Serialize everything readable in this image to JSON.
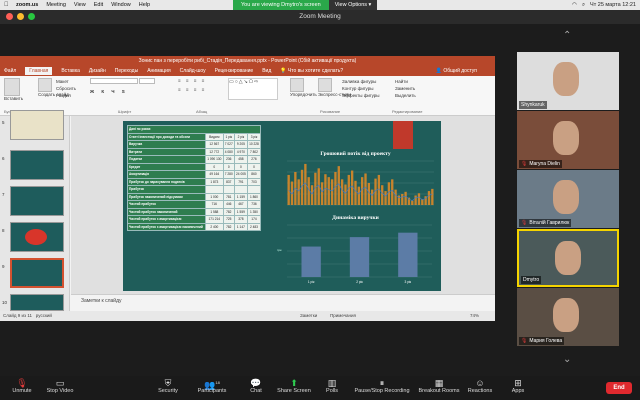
{
  "menubar": {
    "app": "zoom.us",
    "items": [
      "Meeting",
      "View",
      "Edit",
      "Window",
      "Help"
    ],
    "viewing_banner": "You are viewing Dmytro's screen",
    "view_options": "View Options",
    "clock": "Чт 25 марта 12:21"
  },
  "window": {
    "title": "Zoom Meeting"
  },
  "ppt": {
    "title_bar": "Зонис пан з переробіти рибі_Стадія_Передавання.pptx - PowerPoint (Сбій активації продукта)",
    "tabs": [
      "Файл",
      "Главная",
      "Вставка",
      "Дизайн",
      "Переходы",
      "Анимация",
      "Слайд-шоу",
      "Рецензирование",
      "Вид"
    ],
    "active_tab": "Главная",
    "tell_me": "Что вы хотите сделать?",
    "share": "Общий доступ",
    "groups": {
      "clipboard": "Буфер обмена",
      "paste": "Вставить",
      "slides": "Слайды",
      "new_slide": "Создать слайд",
      "layout": "Макет",
      "reset": "Сбросить",
      "section": "Раздел",
      "font": "Шрифт",
      "paragraph": "Абзац",
      "arrange": "Упорядочить",
      "quick_styles": "Экспресс-стили",
      "fill": "Заливка фигуры",
      "outline": "Контур фигуры",
      "effects": "Эффекты фигуры",
      "drawing": "Рисование",
      "find": "Найти",
      "replace": "Заменить",
      "select": "Выделить",
      "editing": "Редактирование"
    },
    "thumb_numbers": [
      "5",
      "6",
      "7",
      "8",
      "9",
      "10"
    ],
    "notes_placeholder": "Заметки к слайду",
    "status_left": "Слайд 9 из 11",
    "status_lang": "русский",
    "status_notes": "Заметки",
    "status_comments": "Примечания",
    "zoom_pct": "74%"
  },
  "slide": {
    "table_header": "Дані по роках",
    "years": [
      "Видатк",
      "1 рік",
      "2 рік",
      "3 рік"
    ],
    "rows": [
      {
        "label": "Статті інвестиції про доходи та обсяги",
        "v": [
          "",
          "",
          "",
          ""
        ]
      },
      {
        "label": "Виручка",
        "v": [
          "12 567",
          "7 027",
          "9 205",
          "10 228"
        ]
      },
      {
        "label": "Витрати",
        "v": [
          "12 772",
          "4 080",
          "4 970",
          "7 802"
        ]
      },
      {
        "label": "Податки",
        "v": [
          "1 090 130",
          "236",
          "458",
          "276"
        ]
      },
      {
        "label": "Кредит",
        "v": [
          "0",
          "0",
          "0",
          "0"
        ]
      },
      {
        "label": "Амортизація",
        "v": [
          "49 164",
          "7 280",
          "24 005",
          "860"
        ]
      },
      {
        "label": "Прибуток до нарахування податків",
        "v": [
          "1 873",
          "837",
          "791",
          "703"
        ]
      },
      {
        "label": "Прибуток",
        "v": [
          "",
          "",
          "",
          ""
        ]
      },
      {
        "label": "Прибуток накопичений підсумком",
        "v": [
          "1 000",
          "781",
          "1 159",
          "1 860"
        ]
      },
      {
        "label": "Чистий прибуток",
        "v": [
          "716",
          "446",
          "467",
          "736"
        ]
      },
      {
        "label": "Чистий прибуток накопичений",
        "v": [
          "1 588",
          "782",
          "1 559",
          "1 350"
        ]
      },
      {
        "label": "Чистий прибуток з амортизацією",
        "v": [
          "171 214",
          "725",
          "378",
          "174"
        ]
      },
      {
        "label": "Чистий прибуток з амортизацією накопичений",
        "v": [
          "2 400",
          "782",
          "1 147",
          "2 483"
        ]
      }
    ],
    "chart1_title": "Грошовий потік від проекту",
    "chart2_title": "Динаміка виручки",
    "chart2_cats": [
      "1 рік",
      "2 рік",
      "3 рік"
    ],
    "chart2_ylabel": "грн"
  },
  "chart_data": [
    {
      "type": "bar",
      "title": "Грошовий потік від проекту",
      "values": [
        820,
        640,
        900,
        700,
        960,
        1120,
        760,
        540,
        880,
        1000,
        620,
        840,
        760,
        700,
        900,
        1060,
        700,
        560,
        820,
        940,
        660,
        500,
        760,
        860,
        600,
        420,
        720,
        820,
        540,
        380,
        620,
        700,
        420,
        260,
        300,
        360,
        200,
        120,
        260,
        320,
        160,
        240,
        380,
        440
      ],
      "series_line": [
        400,
        300,
        460,
        380,
        520,
        600,
        420,
        300,
        480,
        540,
        360,
        460,
        420,
        380,
        500,
        580,
        400,
        320,
        460,
        520,
        380,
        300,
        440,
        480,
        340,
        260,
        400,
        440,
        320,
        240,
        360,
        400,
        260,
        200,
        220,
        240,
        160,
        120,
        200,
        220,
        140,
        180,
        260,
        300
      ],
      "colors": {
        "bar": "#c8842c",
        "line": "#3a7ad4"
      }
    },
    {
      "type": "bar",
      "title": "Динаміка виручки",
      "categories": [
        "1 рік",
        "2 рік",
        "3 рік"
      ],
      "values": [
        7027,
        9205,
        10228
      ],
      "ylim": [
        0,
        12000
      ],
      "colors": {
        "bar": "#5c7ca6"
      }
    }
  ],
  "participants": [
    {
      "name": "Shynkaruk",
      "muted": false,
      "active": false,
      "bg": "#ddd"
    },
    {
      "name": "Maryna Dielin",
      "muted": true,
      "active": false,
      "bg": "#7a4d3a"
    },
    {
      "name": "Віталій Гаврилюк",
      "muted": true,
      "active": false,
      "bg": "#6b7b88"
    },
    {
      "name": "Dmytro",
      "muted": false,
      "active": true,
      "bg": "#4b5a5a"
    },
    {
      "name": "Мария Голева",
      "muted": true,
      "active": false,
      "bg": "#5a4e44"
    }
  ],
  "toolbar": {
    "unmute": "Unmute",
    "stop_video": "Stop Video",
    "security": "Security",
    "participants": "Participants",
    "participants_count": "18",
    "chat": "Chat",
    "share": "Share Screen",
    "polls": "Polls",
    "record": "Pause/Stop Recording",
    "breakout": "Breakout Rooms",
    "reactions": "Reactions",
    "apps": "Apps",
    "end": "End"
  }
}
